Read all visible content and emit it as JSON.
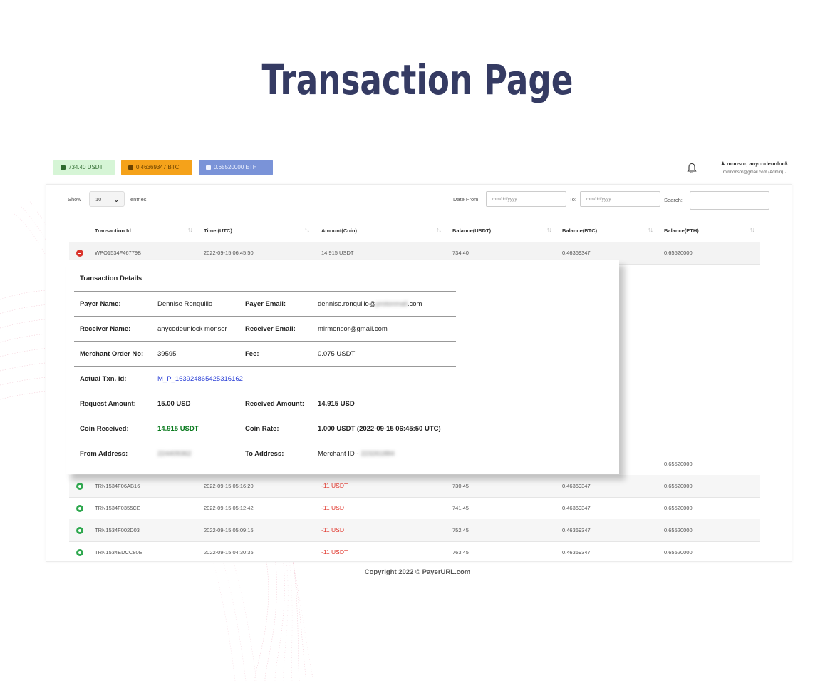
{
  "page_title": "Transaction Page",
  "balances": {
    "usdt": "734.40 USDT",
    "btc": "0.46369347 BTC",
    "eth": "0.65520000 ETH"
  },
  "user": {
    "name": "monsor, anycodeunlock",
    "email": "mirmonsor@gmail.com (Admin)"
  },
  "controls": {
    "show_label": "Show",
    "entries_value": "10",
    "entries_label": "entries",
    "date_from_label": "Date From:",
    "date_from_placeholder": "mm/dd/yyyy",
    "to_label": "To:",
    "date_to_placeholder": "mm/dd/yyyy",
    "search_label": "Search:"
  },
  "table": {
    "columns": [
      "Transaction Id",
      "Time (UTC)",
      "Amount(Coin)",
      "Balance(USDT)",
      "Balance(BTC)",
      "Balance(ETH)"
    ],
    "first_row": {
      "id": "WPO1534F46779B",
      "time": "2022-09-15 06:45:50",
      "amount": "14.915 USDT",
      "balance_usdt": "734.40",
      "balance_btc": "0.46369347",
      "balance_eth": "0.65520000"
    },
    "partial_row": {
      "balance_eth": "0.65520000"
    },
    "rows": [
      {
        "id": "TRN1534F06AB16",
        "time": "2022-09-15 05:16:20",
        "amount": "-11 USDT",
        "balance_usdt": "730.45",
        "balance_btc": "0.46369347",
        "balance_eth": "0.65520000"
      },
      {
        "id": "TRN1534F0355CE",
        "time": "2022-09-15 05:12:42",
        "amount": "-11 USDT",
        "balance_usdt": "741.45",
        "balance_btc": "0.46369347",
        "balance_eth": "0.65520000"
      },
      {
        "id": "TRN1534F002D03",
        "time": "2022-09-15 05:09:15",
        "amount": "-11 USDT",
        "balance_usdt": "752.45",
        "balance_btc": "0.46369347",
        "balance_eth": "0.65520000"
      },
      {
        "id": "TRN1534EDCC80E",
        "time": "2022-09-15 04:30:35",
        "amount": "-11 USDT",
        "balance_usdt": "763.45",
        "balance_btc": "0.46369347",
        "balance_eth": "0.65520000"
      }
    ]
  },
  "details": {
    "title": "Transaction Details",
    "payer_name_label": "Payer Name:",
    "payer_name": "Dennise Ronquillo",
    "payer_email_label": "Payer Email:",
    "payer_email_prefix": "dennise.ronquillo@",
    "payer_email_blurred": "protonmail",
    "payer_email_suffix": ".com",
    "receiver_name_label": "Receiver Name:",
    "receiver_name": "anycodeunlock monsor",
    "receiver_email_label": "Receiver Email:",
    "receiver_email": "mirmonsor@gmail.com",
    "merchant_order_label": "Merchant Order No:",
    "merchant_order": "39595",
    "fee_label": "Fee:",
    "fee": "0.075 USDT",
    "actual_txn_label": "Actual Txn. Id:",
    "actual_txn": "M_P_163924865425316162",
    "request_amount_label": "Request Amount:",
    "request_amount": "15.00 USD",
    "received_amount_label": "Received Amount:",
    "received_amount": "14.915 USD",
    "coin_received_label": "Coin Received:",
    "coin_received": "14.915 USDT",
    "coin_rate_label": "Coin Rate:",
    "coin_rate": "1.000 USDT (2022-09-15 06:45:50 UTC)",
    "from_address_label": "From Address:",
    "from_address_blurred": "224409362",
    "to_address_label": "To Address:",
    "to_address_prefix": "Merchant ID - ",
    "to_address_blurred": "223261884"
  },
  "footer": {
    "copyright": "Copyright 2022 © PayerURL.com"
  },
  "colors": {
    "title": "#353b63",
    "usdt_badge": "#d6f5d6",
    "btc_badge": "#f5a21a",
    "eth_badge": "#7a93d8",
    "negative_amount": "#e0352b",
    "positive_icon": "#2fa84f",
    "close_icon": "#d9332b",
    "link": "#2a3fd6"
  }
}
